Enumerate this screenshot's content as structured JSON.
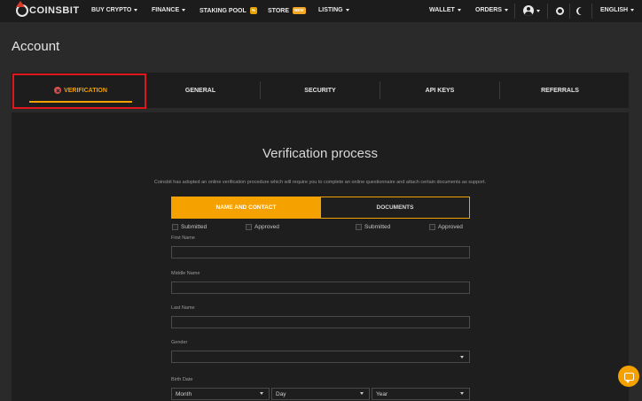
{
  "brand": {
    "name": "COINSBIT"
  },
  "topnav": {
    "buy_crypto": "BUY CRYPTO",
    "finance": "FINANCE",
    "staking_pool": "STAKING POOL",
    "staking_badge": "%",
    "store": "STORE",
    "store_badge": "NEW",
    "listing": "LISTING",
    "wallet": "WALLET",
    "orders": "ORDERS",
    "language": "ENGLISH"
  },
  "page": {
    "title": "Account"
  },
  "tabs": [
    {
      "label": "VERIFICATION",
      "active": true
    },
    {
      "label": "GENERAL"
    },
    {
      "label": "SECURITY"
    },
    {
      "label": "API KEYS"
    },
    {
      "label": "REFERRALS"
    }
  ],
  "verification": {
    "title": "Verification process",
    "description": "Coinsbit has adopted an online verification procedure which will require you to complete an online questionnaire and attach certain documents as support.",
    "steps": [
      "NAME AND CONTACT",
      "DOCUMENTS"
    ],
    "statuses": [
      "Submitted",
      "Approved",
      "Submitted",
      "Approved"
    ],
    "fields": {
      "first_name": "First Name",
      "middle_name": "Middle Name",
      "last_name": "Last Name",
      "gender": "Gender",
      "birth_date": "Birth Date"
    },
    "birth": {
      "month": "Month",
      "day": "Day",
      "year": "Year"
    }
  },
  "colors": {
    "accent": "#f5a100",
    "highlight": "#e0161f",
    "background": "#2a2a2a",
    "panel": "#1e1e1e"
  },
  "icons": [
    "user-icon",
    "gear-icon",
    "moon-icon",
    "chat-icon",
    "error-icon"
  ]
}
